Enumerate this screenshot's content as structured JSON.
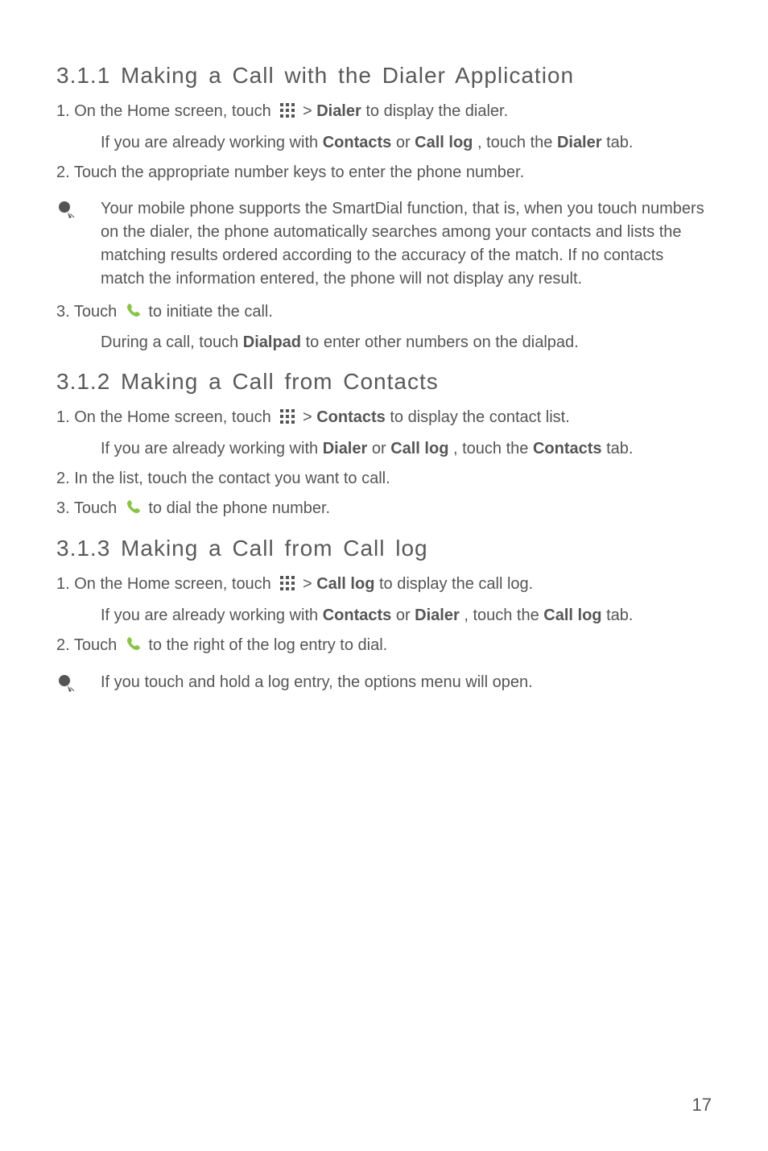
{
  "s1": {
    "heading": "3.1.1  Making a Call with the Dialer Application",
    "step1_a": "1. On the Home screen, touch ",
    "step1_b": " > ",
    "step1_bold": "Dialer",
    "step1_c": " to display the dialer.",
    "indent1_a": "If you are already working with ",
    "indent1_b1": "Contacts",
    "indent1_mid": " or ",
    "indent1_b2": "Call log",
    "indent1_c": ", touch the ",
    "indent1_b3": "Dialer",
    "indent1_d": " tab.",
    "step2": "2. Touch the appropriate number keys to enter the phone number.",
    "note": "Your mobile phone supports the SmartDial function, that is, when you touch numbers on the dialer, the phone automatically searches among your contacts and lists the matching results ordered according to the accuracy of the match. If no contacts match the information entered, the phone will not display any result.",
    "step3_a": "3. Touch ",
    "step3_b": " to initiate the call.",
    "indent3_a": "During a call, touch ",
    "indent3_bold": "Dialpad",
    "indent3_b": " to enter other numbers on the dialpad."
  },
  "s2": {
    "heading": "3.1.2  Making a Call from Contacts",
    "step1_a": "1. On the Home screen, touch ",
    "step1_b": " > ",
    "step1_bold": "Contacts",
    "step1_c": " to display the contact list.",
    "indent1_a": "If you are already working with ",
    "indent1_b1": "Dialer",
    "indent1_mid": " or ",
    "indent1_b2": "Call log",
    "indent1_c": ", touch the ",
    "indent1_b3": "Contacts",
    "indent1_d": " tab.",
    "step2": "2. In the list, touch the contact you want to call.",
    "step3_a": "3. Touch ",
    "step3_b": " to dial the phone number."
  },
  "s3": {
    "heading": "3.1.3  Making a Call from Call log",
    "step1_a": "1. On the Home screen, touch ",
    "step1_b": " > ",
    "step1_bold": "Call log",
    "step1_c": " to display the call log.",
    "indent1_a": "If you are already working with ",
    "indent1_b1": "Contacts",
    "indent1_mid": " or ",
    "indent1_b2": "Dialer",
    "indent1_c": ", touch the ",
    "indent1_b3": "Call log",
    "indent1_d": " tab.",
    "step2_a": "2. Touch ",
    "step2_b": " to the right of the log entry to dial.",
    "note": "If you touch and hold a log entry, the options menu will open."
  },
  "page": "17"
}
